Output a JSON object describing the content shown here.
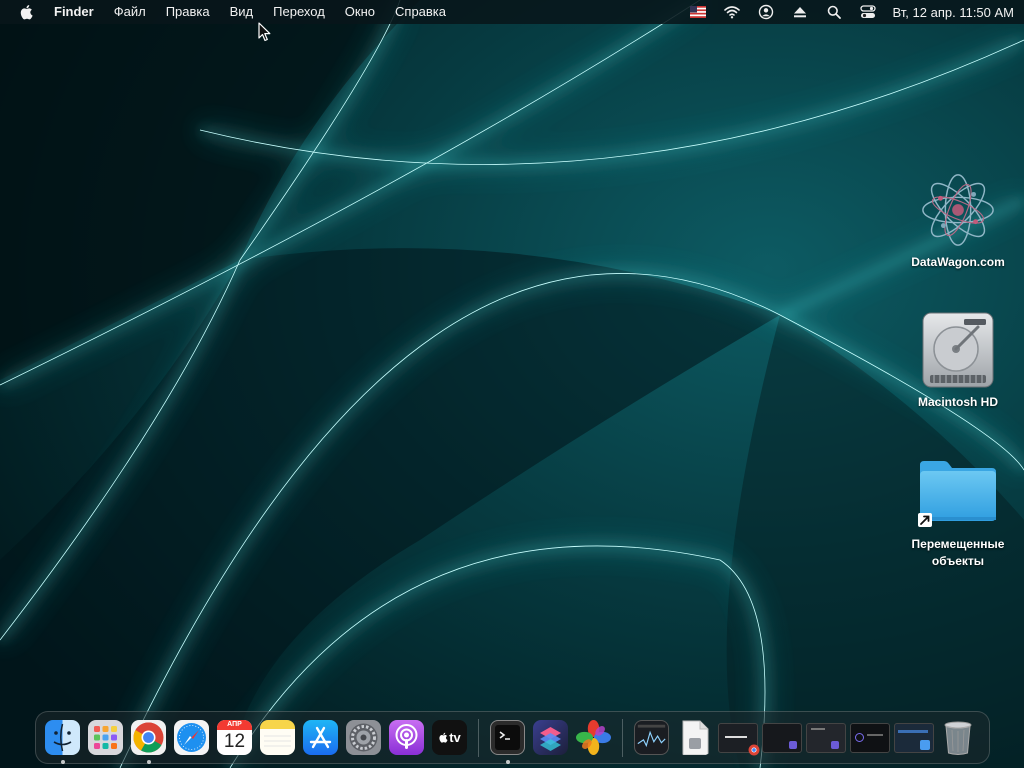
{
  "menubar": {
    "app_name": "Finder",
    "menus": [
      "Файл",
      "Правка",
      "Вид",
      "Переход",
      "Окно",
      "Справка"
    ],
    "status_icons": [
      "flag-us-icon",
      "wifi-icon",
      "user-icon",
      "eject-icon",
      "search-icon",
      "control-center-icon"
    ],
    "clock": "Вт, 12 апр.  11:50 AM"
  },
  "desktop": {
    "icons": [
      {
        "label": "DataWagon.com",
        "icon": "datawagon-icon"
      },
      {
        "label": "Macintosh HD",
        "icon": "hard-drive-icon"
      },
      {
        "label": "Перемещенные объекты",
        "icon": "folder-alias-icon"
      }
    ]
  },
  "dock": {
    "calendar": {
      "month": "АПР",
      "day": "12"
    },
    "appletv_label": "tv",
    "items": [
      {
        "name": "finder",
        "running": true
      },
      {
        "name": "launchpad",
        "running": false
      },
      {
        "name": "chrome",
        "running": true
      },
      {
        "name": "safari",
        "running": false
      },
      {
        "name": "calendar",
        "running": false
      },
      {
        "name": "notes",
        "running": false
      },
      {
        "name": "app-store",
        "running": false
      },
      {
        "name": "system-preferences",
        "running": false
      },
      {
        "name": "podcasts",
        "running": false
      },
      {
        "name": "apple-tv",
        "running": false
      },
      {
        "name": "terminal",
        "running": true
      },
      {
        "name": "shortcuts",
        "running": false
      },
      {
        "name": "photos-flower",
        "running": false
      },
      {
        "name": "activity-monitor",
        "running": false
      },
      {
        "name": "document",
        "running": false
      },
      {
        "name": "minimized-window-1",
        "running": false
      },
      {
        "name": "minimized-window-2",
        "running": false
      },
      {
        "name": "minimized-window-3",
        "running": false
      },
      {
        "name": "minimized-window-4",
        "running": false
      },
      {
        "name": "minimized-window-5",
        "running": false
      },
      {
        "name": "trash",
        "running": false
      }
    ]
  },
  "colors": {
    "glow": "#3ee6e6",
    "menubar_bg": "#08161a"
  }
}
